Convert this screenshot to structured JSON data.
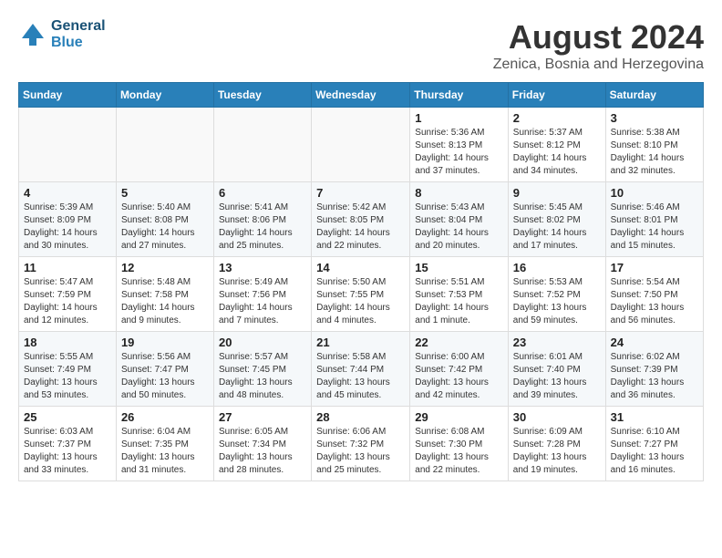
{
  "header": {
    "logo_line1": "General",
    "logo_line2": "Blue",
    "month": "August 2024",
    "location": "Zenica, Bosnia and Herzegovina"
  },
  "weekdays": [
    "Sunday",
    "Monday",
    "Tuesday",
    "Wednesday",
    "Thursday",
    "Friday",
    "Saturday"
  ],
  "weeks": [
    [
      {
        "day": "",
        "info": ""
      },
      {
        "day": "",
        "info": ""
      },
      {
        "day": "",
        "info": ""
      },
      {
        "day": "",
        "info": ""
      },
      {
        "day": "1",
        "info": "Sunrise: 5:36 AM\nSunset: 8:13 PM\nDaylight: 14 hours\nand 37 minutes."
      },
      {
        "day": "2",
        "info": "Sunrise: 5:37 AM\nSunset: 8:12 PM\nDaylight: 14 hours\nand 34 minutes."
      },
      {
        "day": "3",
        "info": "Sunrise: 5:38 AM\nSunset: 8:10 PM\nDaylight: 14 hours\nand 32 minutes."
      }
    ],
    [
      {
        "day": "4",
        "info": "Sunrise: 5:39 AM\nSunset: 8:09 PM\nDaylight: 14 hours\nand 30 minutes."
      },
      {
        "day": "5",
        "info": "Sunrise: 5:40 AM\nSunset: 8:08 PM\nDaylight: 14 hours\nand 27 minutes."
      },
      {
        "day": "6",
        "info": "Sunrise: 5:41 AM\nSunset: 8:06 PM\nDaylight: 14 hours\nand 25 minutes."
      },
      {
        "day": "7",
        "info": "Sunrise: 5:42 AM\nSunset: 8:05 PM\nDaylight: 14 hours\nand 22 minutes."
      },
      {
        "day": "8",
        "info": "Sunrise: 5:43 AM\nSunset: 8:04 PM\nDaylight: 14 hours\nand 20 minutes."
      },
      {
        "day": "9",
        "info": "Sunrise: 5:45 AM\nSunset: 8:02 PM\nDaylight: 14 hours\nand 17 minutes."
      },
      {
        "day": "10",
        "info": "Sunrise: 5:46 AM\nSunset: 8:01 PM\nDaylight: 14 hours\nand 15 minutes."
      }
    ],
    [
      {
        "day": "11",
        "info": "Sunrise: 5:47 AM\nSunset: 7:59 PM\nDaylight: 14 hours\nand 12 minutes."
      },
      {
        "day": "12",
        "info": "Sunrise: 5:48 AM\nSunset: 7:58 PM\nDaylight: 14 hours\nand 9 minutes."
      },
      {
        "day": "13",
        "info": "Sunrise: 5:49 AM\nSunset: 7:56 PM\nDaylight: 14 hours\nand 7 minutes."
      },
      {
        "day": "14",
        "info": "Sunrise: 5:50 AM\nSunset: 7:55 PM\nDaylight: 14 hours\nand 4 minutes."
      },
      {
        "day": "15",
        "info": "Sunrise: 5:51 AM\nSunset: 7:53 PM\nDaylight: 14 hours\nand 1 minute."
      },
      {
        "day": "16",
        "info": "Sunrise: 5:53 AM\nSunset: 7:52 PM\nDaylight: 13 hours\nand 59 minutes."
      },
      {
        "day": "17",
        "info": "Sunrise: 5:54 AM\nSunset: 7:50 PM\nDaylight: 13 hours\nand 56 minutes."
      }
    ],
    [
      {
        "day": "18",
        "info": "Sunrise: 5:55 AM\nSunset: 7:49 PM\nDaylight: 13 hours\nand 53 minutes."
      },
      {
        "day": "19",
        "info": "Sunrise: 5:56 AM\nSunset: 7:47 PM\nDaylight: 13 hours\nand 50 minutes."
      },
      {
        "day": "20",
        "info": "Sunrise: 5:57 AM\nSunset: 7:45 PM\nDaylight: 13 hours\nand 48 minutes."
      },
      {
        "day": "21",
        "info": "Sunrise: 5:58 AM\nSunset: 7:44 PM\nDaylight: 13 hours\nand 45 minutes."
      },
      {
        "day": "22",
        "info": "Sunrise: 6:00 AM\nSunset: 7:42 PM\nDaylight: 13 hours\nand 42 minutes."
      },
      {
        "day": "23",
        "info": "Sunrise: 6:01 AM\nSunset: 7:40 PM\nDaylight: 13 hours\nand 39 minutes."
      },
      {
        "day": "24",
        "info": "Sunrise: 6:02 AM\nSunset: 7:39 PM\nDaylight: 13 hours\nand 36 minutes."
      }
    ],
    [
      {
        "day": "25",
        "info": "Sunrise: 6:03 AM\nSunset: 7:37 PM\nDaylight: 13 hours\nand 33 minutes."
      },
      {
        "day": "26",
        "info": "Sunrise: 6:04 AM\nSunset: 7:35 PM\nDaylight: 13 hours\nand 31 minutes."
      },
      {
        "day": "27",
        "info": "Sunrise: 6:05 AM\nSunset: 7:34 PM\nDaylight: 13 hours\nand 28 minutes."
      },
      {
        "day": "28",
        "info": "Sunrise: 6:06 AM\nSunset: 7:32 PM\nDaylight: 13 hours\nand 25 minutes."
      },
      {
        "day": "29",
        "info": "Sunrise: 6:08 AM\nSunset: 7:30 PM\nDaylight: 13 hours\nand 22 minutes."
      },
      {
        "day": "30",
        "info": "Sunrise: 6:09 AM\nSunset: 7:28 PM\nDaylight: 13 hours\nand 19 minutes."
      },
      {
        "day": "31",
        "info": "Sunrise: 6:10 AM\nSunset: 7:27 PM\nDaylight: 13 hours\nand 16 minutes."
      }
    ]
  ]
}
